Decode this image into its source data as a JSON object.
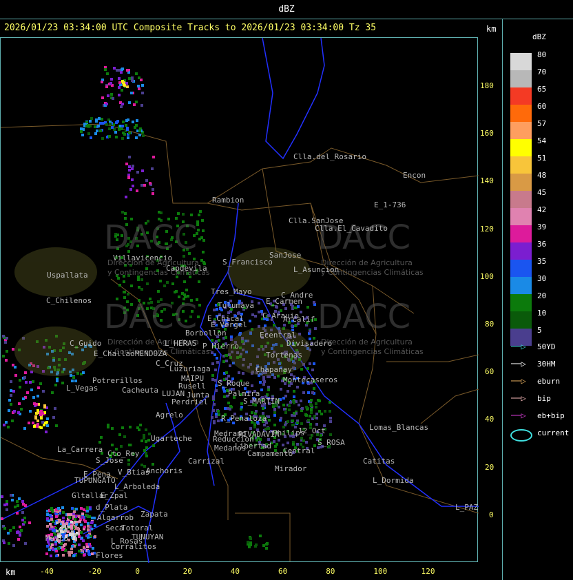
{
  "window": {
    "title": "dBZ"
  },
  "header": {
    "text": "2026/01/23 03:34:00 UTC Composite Tracks to 2026/01/23 03:34:00 Tz 35",
    "km_top": "km",
    "km_bottom": "km"
  },
  "y_ticks": [
    "180",
    "160",
    "140",
    "120",
    "100",
    "80",
    "60",
    "40",
    "20",
    "0"
  ],
  "x_ticks": [
    "-40",
    "-20",
    "0",
    "20",
    "40",
    "60",
    "80",
    "100",
    "120"
  ],
  "legend": {
    "title": "dBZ",
    "levels": [
      {
        "value": "80",
        "color": "#d8d8d8"
      },
      {
        "value": "70",
        "color": "#b8b8b8"
      },
      {
        "value": "65",
        "color": "#f43a24"
      },
      {
        "value": "60",
        "color": "#ff6a0a"
      },
      {
        "value": "57",
        "color": "#fe9e5f"
      },
      {
        "value": "54",
        "color": "#ffff00"
      },
      {
        "value": "51",
        "color": "#f8c53a"
      },
      {
        "value": "48",
        "color": "#d99a45"
      },
      {
        "value": "45",
        "color": "#c87a8c"
      },
      {
        "value": "42",
        "color": "#e082b0"
      },
      {
        "value": "39",
        "color": "#dd1b9b"
      },
      {
        "value": "36",
        "color": "#7b1ed0"
      },
      {
        "value": "35",
        "color": "#1a55f0"
      },
      {
        "value": "30",
        "color": "#1a8ae6"
      },
      {
        "value": "20",
        "color": "#0c7a0c"
      },
      {
        "value": "10",
        "color": "#0a5a0a"
      },
      {
        "value": "5",
        "color": "#4a3e8e"
      }
    ],
    "tracks": [
      {
        "label": "50YD",
        "color": "#40d8d8"
      },
      {
        "label": "30HM",
        "color": "#ffffff"
      },
      {
        "label": "eburn",
        "color": "#e8b060"
      },
      {
        "label": "bip",
        "color": "#ffc0c0"
      },
      {
        "label": "eb+bip",
        "color": "#e040e0"
      },
      {
        "label": "current",
        "color": "#40e0e0"
      }
    ]
  },
  "places": [
    "Clla.del_Rosario",
    "Encon",
    "Rambion",
    "E_1-736",
    "Clla.SanJose",
    "Clla.El_Cavadito",
    "Villavicencio",
    "S_Francisco",
    "SanJose",
    "L_Asuncion",
    "Uspallata",
    "Capdevila",
    "Tres_Mayo",
    "C_Andre",
    "C_Chilenos",
    "Tulumaya",
    "E_Carmen",
    "E_Chical",
    "C_Arauio",
    "Arcalif",
    "E_Vergel",
    "Borbollon",
    "C_Guido",
    "L_HERAS",
    "Ecentral",
    "Divisadero",
    "E_Challao",
    "MENDOZA",
    "P_Hierro",
    "C_Cruz",
    "Luzuriaga",
    "MAIPU",
    "Potrerillos",
    "Cacheuta",
    "L_Vegas",
    "LUJAN",
    "Perdriel",
    "S_MARTIN",
    "Agrelo",
    "R_Penaloza",
    "Lomas_Blancas",
    "Ugarteche",
    "Medrano",
    "RIVADAVIA",
    "12_Oct",
    "S_ROSA",
    "La_Carrera",
    "Cto_Rey",
    "S_Jose",
    "Carrizal",
    "Catitas",
    "Anchoris",
    "Campamento",
    "Mirador",
    "E_Pena",
    "V_Btias",
    "TUPUNGATO",
    "L_Arboleda",
    "L_Dormida",
    "Gltallar",
    "E_Zpal",
    "L_PAZ",
    "d_Plata",
    "Zapata",
    "Algarrob",
    "Seca",
    "Totoral",
    "TUNUYAN",
    "Masco",
    "L_Rosas",
    "Flores",
    "Corralitos",
    "Rusell",
    "Junta",
    "Palmira",
    "Medanos",
    "Reduccion",
    "Libertad",
    "Central",
    "Philips",
    "Chapanay",
    "S_Roque",
    "Tortenas",
    "Montecaseros"
  ],
  "watermarks": [
    {
      "brand": "DACC",
      "line1": "Dirección de Agricultura",
      "line2": "y Contingencias Climáticas"
    },
    {
      "brand": "DACC",
      "line1": "Dirección de Agricultura",
      "line2": "y Contingencias Climáticas"
    },
    {
      "brand": "DACC",
      "line1": "Dirección de Agricultura",
      "line2": "y Contingencias Climáticas"
    },
    {
      "brand": "DACC",
      "line1": "Dirección de Agricultura",
      "line2": "y Contingencias Climáticas"
    }
  ]
}
